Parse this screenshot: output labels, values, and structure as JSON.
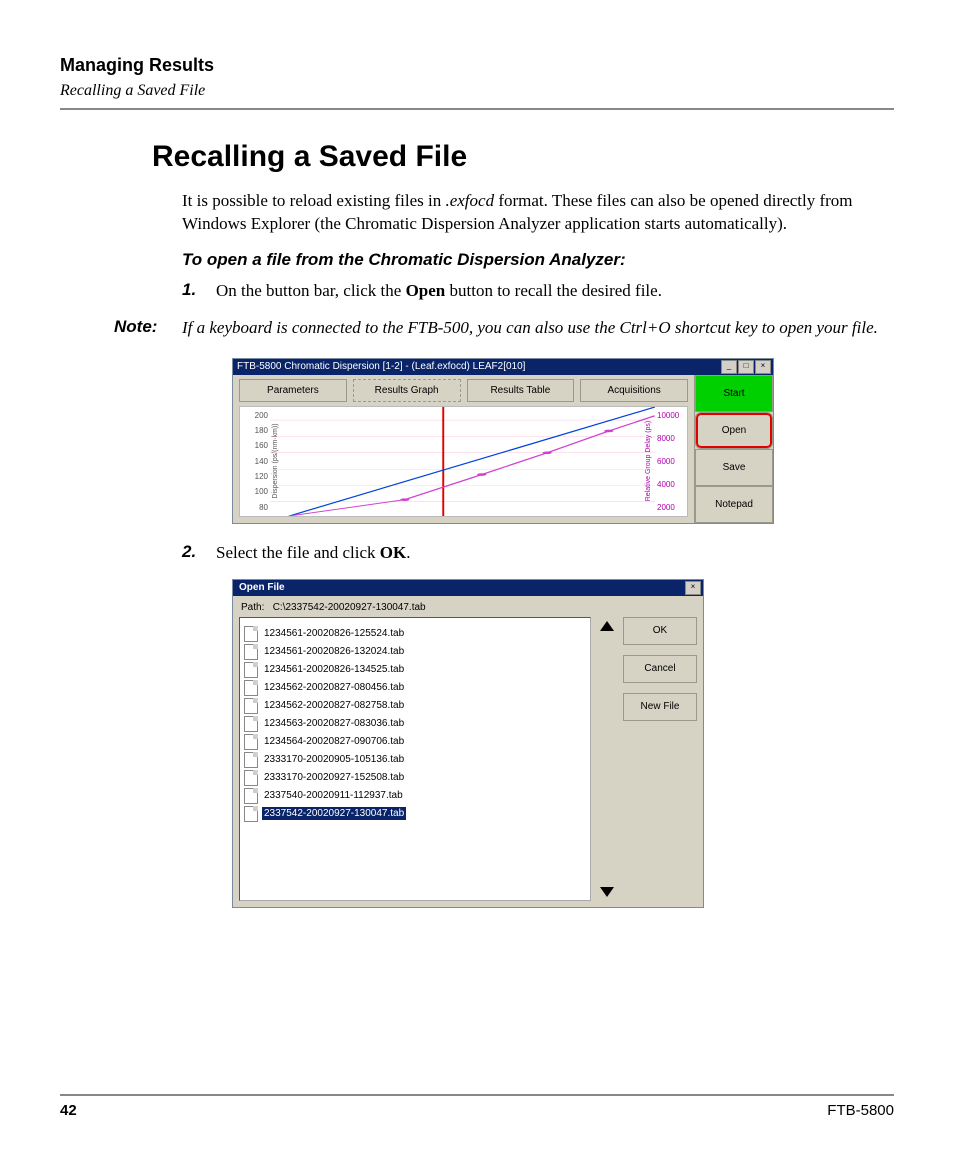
{
  "header": {
    "chapter": "Managing Results",
    "section": "Recalling a Saved File"
  },
  "title": "Recalling a Saved File",
  "intro_pre": "It is possible to reload existing files in ",
  "intro_em": ".exfocd",
  "intro_post": " format. These files can also be opened directly from Windows Explorer (the Chromatic Dispersion Analyzer application starts automatically).",
  "subhead": "To open a file from the Chromatic Dispersion Analyzer:",
  "step1": {
    "num": "1.",
    "pre": "On the button bar, click the ",
    "bold": "Open",
    "post": " button to recall the desired file."
  },
  "note": {
    "label": "Note:",
    "text": "If a keyboard is connected to the FTB-500, you can also use the Ctrl+O shortcut key to open your file."
  },
  "step2": {
    "num": "2.",
    "pre": "Select the file and click ",
    "bold": "OK",
    "post": "."
  },
  "shot1": {
    "title": "FTB-5800 Chromatic Dispersion  [1-2] - (Leaf.exfocd) LEAF2[010]",
    "win_min": "_",
    "win_max": "□",
    "win_close": "×",
    "tabs": [
      "Parameters",
      "Results Graph",
      "Results Table",
      "Acquisitions"
    ],
    "active_tab": 1,
    "y1_label": "Dispersion (ps/(nm·km))",
    "y1_ticks": [
      "200",
      "180",
      "160",
      "140",
      "120",
      "100",
      "80"
    ],
    "y2_label": "Relative Group Delay (ps)",
    "y2_ticks": [
      "10000",
      "8000",
      "6000",
      "4000",
      "2000"
    ],
    "buttons": {
      "start": "Start",
      "open": "Open",
      "save": "Save",
      "notepad": "Notepad"
    }
  },
  "shot2": {
    "title": "Open File",
    "close": "×",
    "path_label": "Path:",
    "path_value": "C:\\2337542-20020927-130047.tab",
    "files": [
      "1234561-20020826-125524.tab",
      "1234561-20020826-132024.tab",
      "1234561-20020826-134525.tab",
      "1234562-20020827-080456.tab",
      "1234562-20020827-082758.tab",
      "1234563-20020827-083036.tab",
      "1234564-20020827-090706.tab",
      "2333170-20020905-105136.tab",
      "2333170-20020927-152508.tab",
      "2337540-20020911-112937.tab",
      "2337542-20020927-130047.tab"
    ],
    "selected_index": 10,
    "buttons": {
      "ok": "OK",
      "cancel": "Cancel",
      "newfile": "New File"
    }
  },
  "footer": {
    "page": "42",
    "product": "FTB-5800"
  }
}
